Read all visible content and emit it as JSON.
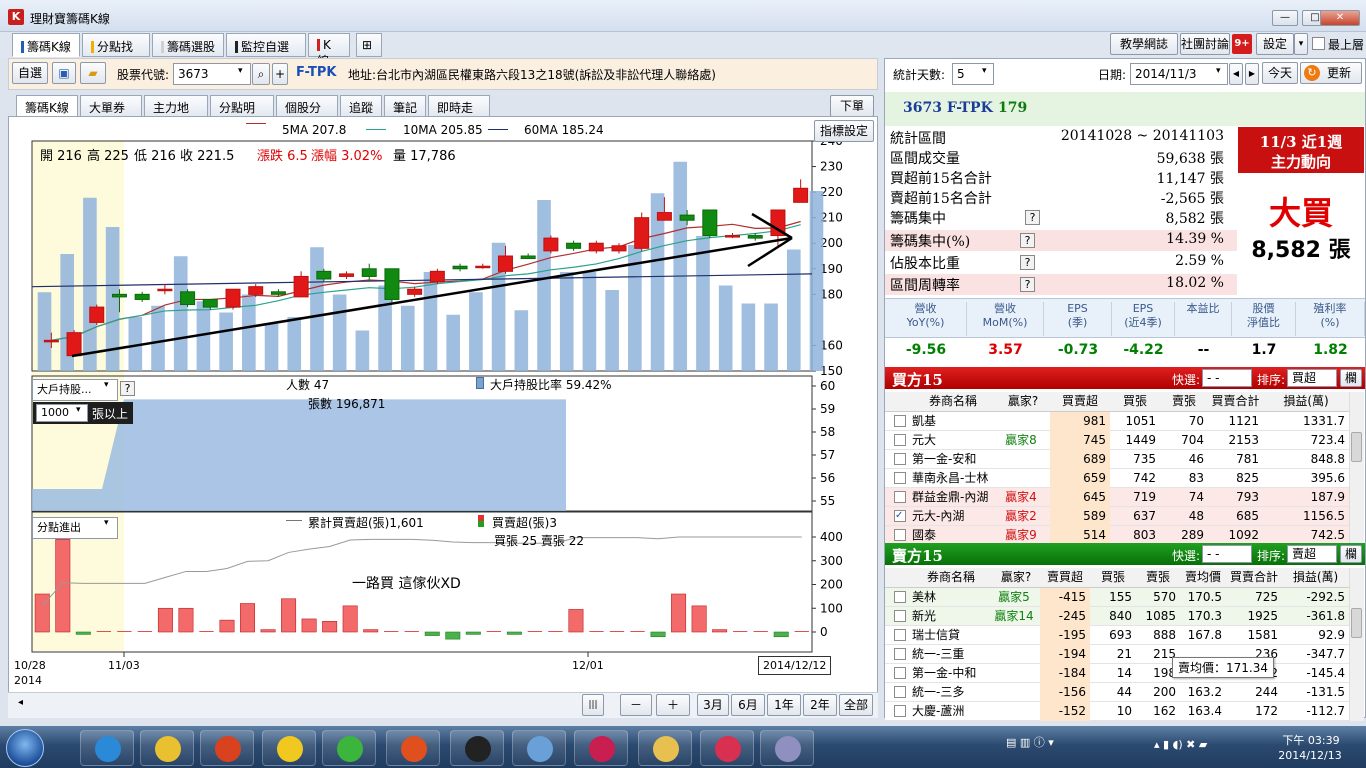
{
  "window": {
    "title": "理財寶籌碼K線",
    "min": "—",
    "max": "□",
    "close": "✕"
  },
  "top_tabs": [
    {
      "label": "籌碼K線",
      "color": "#1f5fb8"
    },
    {
      "label": "分點找股",
      "color": "#f0b000"
    },
    {
      "label": "籌碼選股",
      "color": "#d0d0d0"
    },
    {
      "label": "監控自選股",
      "color": "#222222"
    },
    {
      "label": "K線",
      "color": "#d02020"
    }
  ],
  "top_right": {
    "b1": "教學網誌",
    "b2": "社團討論",
    "badge": "9+",
    "b3": "設定",
    "b4": "▾",
    "topmost": "最上層"
  },
  "toolbar": {
    "watch": "自選",
    "code_label": "股票代號:",
    "code": "3673",
    "code_arrow": "▾",
    "plus": "+",
    "name": "F-TPK",
    "address": "地址:台北市內湖區民權東路六段13之18號(訴訟及非訟代理人聯絡處)"
  },
  "sub_tabs": [
    "籌碼K線",
    "大單券商",
    "主力地圖",
    "分點明細",
    "個股分析",
    "追蹤",
    "筆記",
    "即時走勢"
  ],
  "sub_right": {
    "b1": "下單",
    "b2": "指標設定"
  },
  "ma": {
    "ma5": "5MA 207.8",
    "ma10": "10MA 205.85",
    "ma60": "60MA 185.24"
  },
  "ohlc": {
    "o": "開 216",
    "h": "高 225",
    "l": "低 216",
    "c": "收 221.5",
    "chg": "漲跌 6.5",
    "pct": "漲幅  3.02%",
    "vol": "量 17,786"
  },
  "price_axis": [
    "240",
    "230",
    "220",
    "210",
    "200",
    "190",
    "180",
    "160",
    "150"
  ],
  "holder": {
    "sel": "大戶持股...",
    "q": "?",
    "people": "人數 47",
    "ratio": "大戶持股比率 59.42%",
    "shares": "張數 196,871",
    "thr": "1000",
    "thr_unit": "張以上",
    "axis": [
      "60",
      "59",
      "58",
      "57",
      "56",
      "55"
    ],
    "fill_level": 0.85
  },
  "flow": {
    "sel": "分點進出",
    "cum": "累計買賣超(張)1,601",
    "net": "買賣超(張)3",
    "buysell": "買張 25 賣張 22",
    "annot": "一路買  這傢伙XD",
    "axis": [
      "400",
      "300",
      "200",
      "100",
      "0"
    ]
  },
  "dates": {
    "d1": "10/28",
    "y1": "2014",
    "d2": "11/03",
    "d3": "12/01",
    "end": "2014/12/12"
  },
  "zoom_btns": [
    "3月",
    "6月",
    "1年",
    "2年",
    "全部"
  ],
  "zoom_icons": {
    "bars": "|||",
    "minus": "－",
    "plus": "＋",
    "arrow": "◂"
  },
  "right": {
    "days_label": "統計天數:",
    "days": "5",
    "date_label": "日期:",
    "date": "2014/11/3",
    "today": "今天",
    "refresh": "更新",
    "head_code": "3673 F-TPK",
    "head_val": "179",
    "stats": [
      {
        "l": "統計區間",
        "v": "20141028 ~ 20141103",
        "q": false
      },
      {
        "l": "區間成交量",
        "v": "59,638 張",
        "q": false
      },
      {
        "l": "買超前15名合計",
        "v": "11,147 張",
        "q": false
      },
      {
        "l": "賣超前15名合計",
        "v": "-2,565 張",
        "q": false
      },
      {
        "l": "籌碼集中",
        "v": "8,582 張",
        "q": true
      },
      {
        "l": "籌碼集中(%)",
        "v": "14.39 %",
        "q": true
      },
      {
        "l": "佔股本比重",
        "v": "2.59 %",
        "q": true
      },
      {
        "l": "區間周轉率",
        "v": "18.02 %",
        "q": true
      }
    ],
    "box_title1": "11/3 近1週",
    "box_title2": "主力動向",
    "box_verdict": "大買",
    "box_amount": "8,582 張",
    "metrics": [
      {
        "l": "營收\nYoY(%)",
        "v": "-9.56",
        "c": "#008000"
      },
      {
        "l": "營收\nMoM(%)",
        "v": "3.57",
        "c": "#e00000"
      },
      {
        "l": "EPS\n(季)",
        "v": "-0.73",
        "c": "#008000"
      },
      {
        "l": "EPS\n(近4季)",
        "v": "-4.22",
        "c": "#008000"
      },
      {
        "l": "本益比",
        "v": "--",
        "c": "#000000"
      },
      {
        "l": "股價\n淨值比",
        "v": "1.7",
        "c": "#000000"
      },
      {
        "l": "殖利率\n(%)",
        "v": "1.82",
        "c": "#008000"
      }
    ],
    "buy15": {
      "title": "買方15",
      "quick": "快選:",
      "quick_v": "- -",
      "sort": "排序:",
      "sort_v": "買超",
      "btn": "欄",
      "cols": [
        "券商名稱",
        "贏家?",
        "買賣超",
        "買張",
        "賣張",
        "買賣合計",
        "損益(萬)"
      ],
      "rows": [
        [
          "凱基",
          "",
          "981",
          "1051",
          "70",
          "1121",
          "1331.7",
          false
        ],
        [
          "元大",
          "贏家8",
          "745",
          "1449",
          "704",
          "2153",
          "723.4",
          false
        ],
        [
          "第一金-安和",
          "",
          "689",
          "735",
          "46",
          "781",
          "848.8",
          false
        ],
        [
          "華南永昌-士林",
          "",
          "659",
          "742",
          "83",
          "825",
          "395.6",
          false
        ],
        [
          "群益金鼎-內湖",
          "贏家4",
          "645",
          "719",
          "74",
          "793",
          "187.9",
          false
        ],
        [
          "元大-內湖",
          "贏家2",
          "589",
          "637",
          "48",
          "685",
          "1156.5",
          true
        ],
        [
          "國泰",
          "贏家9",
          "514",
          "803",
          "289",
          "1092",
          "742.5",
          false
        ]
      ]
    },
    "sell15": {
      "title": "賣方15",
      "quick": "快選:",
      "quick_v": "- -",
      "sort": "排序:",
      "sort_v": "賣超",
      "btn": "欄",
      "cols": [
        "券商名稱",
        "贏家?",
        "賣買超",
        "買張",
        "賣張",
        "賣均價",
        "買賣合計",
        "損益(萬)"
      ],
      "rows": [
        [
          "美林",
          "贏家5",
          "-415",
          "155",
          "570",
          "170.5",
          "725",
          "-292.5"
        ],
        [
          "新光",
          "贏家14",
          "-245",
          "840",
          "1085",
          "170.3",
          "1925",
          "-361.8"
        ],
        [
          "瑞士信貸",
          "",
          "-195",
          "693",
          "888",
          "167.8",
          "1581",
          "92.9"
        ],
        [
          "統一-三重",
          "",
          "-194",
          "21",
          "215",
          "",
          "236",
          "-347.7"
        ],
        [
          "第一金-中和",
          "",
          "-184",
          "14",
          "198",
          "170.3",
          "212",
          "-145.4"
        ],
        [
          "統一-三多",
          "",
          "-156",
          "44",
          "200",
          "163.2",
          "244",
          "-131.5"
        ],
        [
          "大慶-蘆洲",
          "",
          "-152",
          "10",
          "162",
          "163.4",
          "172",
          "-112.7"
        ]
      ],
      "tooltip": "賣均價：171.34"
    }
  },
  "taskbar": {
    "time": "下午 03:39",
    "date": "2014/12/13"
  },
  "chart_data": {
    "type": "candlestick",
    "candles": [
      {
        "o": 162,
        "c": 162,
        "h": 165,
        "l": 159
      },
      {
        "o": 156,
        "c": 165,
        "h": 166,
        "l": 156
      },
      {
        "o": 169,
        "c": 175,
        "h": 176,
        "l": 168
      },
      {
        "o": 180,
        "c": 179,
        "h": 182,
        "l": 173
      },
      {
        "o": 180,
        "c": 178,
        "h": 181,
        "l": 177
      },
      {
        "o": 182,
        "c": 182,
        "h": 184,
        "l": 180
      },
      {
        "o": 181,
        "c": 176,
        "h": 182,
        "l": 175
      },
      {
        "o": 178,
        "c": 175,
        "h": 178,
        "l": 174
      },
      {
        "o": 175,
        "c": 182,
        "h": 182,
        "l": 174
      },
      {
        "o": 180,
        "c": 183,
        "h": 184,
        "l": 179
      },
      {
        "o": 181,
        "c": 180,
        "h": 182,
        "l": 179
      },
      {
        "o": 179,
        "c": 187,
        "h": 189,
        "l": 179
      },
      {
        "o": 189,
        "c": 186,
        "h": 190,
        "l": 185
      },
      {
        "o": 187,
        "c": 188,
        "h": 189,
        "l": 186
      },
      {
        "o": 190,
        "c": 187,
        "h": 192,
        "l": 185
      },
      {
        "o": 190,
        "c": 178,
        "h": 190,
        "l": 177
      },
      {
        "o": 180,
        "c": 182,
        "h": 183,
        "l": 179
      },
      {
        "o": 185,
        "c": 189,
        "h": 190,
        "l": 184
      },
      {
        "o": 191,
        "c": 190,
        "h": 192,
        "l": 189
      },
      {
        "o": 191,
        "c": 191,
        "h": 192,
        "l": 190
      },
      {
        "o": 189,
        "c": 195,
        "h": 199,
        "l": 188
      },
      {
        "o": 195,
        "c": 194,
        "h": 196,
        "l": 194
      },
      {
        "o": 197,
        "c": 202,
        "h": 203,
        "l": 196
      },
      {
        "o": 200,
        "c": 198,
        "h": 201,
        "l": 197
      },
      {
        "o": 197,
        "c": 200,
        "h": 201,
        "l": 196
      },
      {
        "o": 197,
        "c": 199,
        "h": 200,
        "l": 196
      },
      {
        "o": 198,
        "c": 210,
        "h": 212,
        "l": 197
      },
      {
        "o": 209,
        "c": 212,
        "h": 218,
        "l": 209
      },
      {
        "o": 211,
        "c": 209,
        "h": 213,
        "l": 207
      },
      {
        "o": 213,
        "c": 203,
        "h": 213,
        "l": 202
      },
      {
        "o": 203,
        "c": 203,
        "h": 204,
        "l": 202
      },
      {
        "o": 203,
        "c": 202,
        "h": 204,
        "l": 201
      },
      {
        "o": 203,
        "c": 213,
        "h": 213,
        "l": 199
      },
      {
        "o": 216,
        "c": 221.5,
        "h": 225,
        "l": 216
      }
    ],
    "volume_rel": [
      0.35,
      0.52,
      0.77,
      0.64,
      0.24,
      0.29,
      0.51,
      0.31,
      0.26,
      0.34,
      0.21,
      0.24,
      0.55,
      0.34,
      0.18,
      0.38,
      0.29,
      0.44,
      0.25,
      0.35,
      0.57,
      0.27,
      0.76,
      0.44,
      0.44,
      0.36,
      0.56,
      0.79,
      0.93,
      0.6,
      0.38,
      0.3,
      0.3,
      0.54,
      0.8
    ],
    "flow_values": [
      160,
      390,
      -10,
      0,
      0,
      0,
      100,
      100,
      0,
      50,
      120,
      10,
      140,
      55,
      45,
      110,
      10,
      0,
      0,
      -15,
      -30,
      -10,
      0,
      -10,
      0,
      0,
      95,
      0,
      0,
      0,
      -20,
      160,
      110,
      10,
      0,
      0,
      -20,
      0
    ],
    "price_ylim": [
      150,
      240
    ],
    "flow_ylim": [
      -50,
      400
    ]
  }
}
